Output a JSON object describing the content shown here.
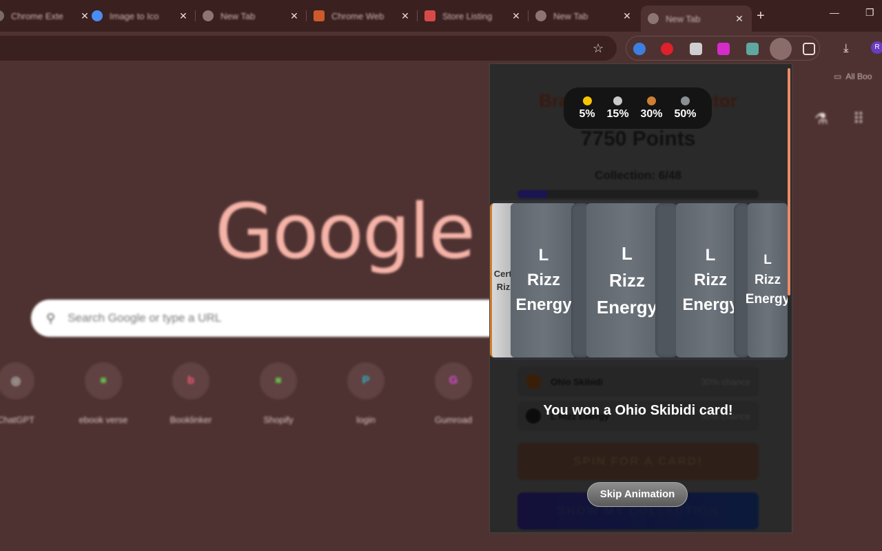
{
  "tabs": [
    {
      "title": "Chrome Exte",
      "icon_color": "#7a6a68"
    },
    {
      "title": "Image to Ico",
      "icon_color": "#4a8ef5"
    },
    {
      "title": "New Tab",
      "icon_color": "#8c7574"
    },
    {
      "title": "Chrome Web",
      "icon_color": "#cc5a2a"
    },
    {
      "title": "Store Listing",
      "icon_color": "#d84a4a"
    },
    {
      "title": "New Tab",
      "icon_color": "#8c7574"
    },
    {
      "title": "New Tab",
      "icon_color": "#8c7574"
    }
  ],
  "bookmarks": {
    "all_bookmarks": "All Boo"
  },
  "ntp": {
    "logo": "Google",
    "search_placeholder": "Search Google or type a URL",
    "shortcuts": [
      {
        "label": "ChatGPT",
        "glyph": "◎",
        "color": "#cfcfcf"
      },
      {
        "label": "ebook verse",
        "glyph": "■",
        "color": "#66b84a"
      },
      {
        "label": "Booklinker",
        "glyph": "b",
        "color": "#ff5a7a"
      },
      {
        "label": "Shopify",
        "glyph": "■",
        "color": "#66b84a"
      },
      {
        "label": "login",
        "glyph": "P",
        "color": "#2fb5d0"
      },
      {
        "label": "Gumroad",
        "glyph": "G",
        "color": "#e44ce0"
      }
    ]
  },
  "popup": {
    "title": "Brainrot Card Collector",
    "points": "7750 Points",
    "collection": "Collection: 6/48",
    "collection_progress": 0.125,
    "legend": [
      {
        "value": "5%",
        "color": "#f7c600"
      },
      {
        "value": "15%",
        "color": "#c9c9c9"
      },
      {
        "value": "30%",
        "color": "#cd7f32"
      },
      {
        "value": "50%",
        "color": "#8a8f94"
      }
    ],
    "cards": [
      {
        "lines": [
          "Certifi",
          "Rizzl"
        ],
        "edge": true
      },
      {
        "lines": [
          "L",
          "Rizz",
          "Energy"
        ],
        "edge": false
      },
      {
        "lines": [
          "L",
          "Rizz",
          "Energy"
        ],
        "edge": false
      },
      {
        "lines": [
          "L",
          "Rizz",
          "Energy"
        ],
        "edge": false
      },
      {
        "lines": [
          "L",
          "Rizz",
          "Energy"
        ],
        "edge": false
      }
    ],
    "rarities": [
      {
        "name": "Ohio Skibidi",
        "chance": "30% chance",
        "color": "#3a1f08"
      },
      {
        "name": "L Rizz Energy",
        "chance": "50% chance",
        "color": "#0c0c0c"
      }
    ],
    "win_message": "You won a Ohio Skibidi card!",
    "spin_button": "SPIN FOR A CARD!",
    "collection_button": "SHOW MY COLLECTION",
    "skip_button": "Skip Animation"
  }
}
